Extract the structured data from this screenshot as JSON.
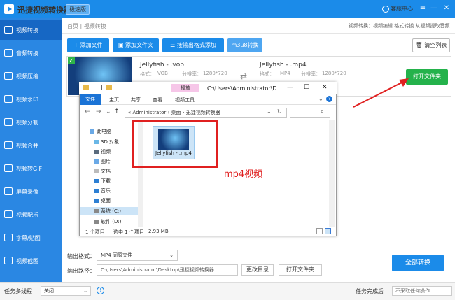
{
  "titlebar": {
    "app_title": "迅捷视频转换器",
    "badge": "极速版",
    "help_label": "客服中心"
  },
  "sidebar": {
    "items": [
      {
        "label": "视频转换",
        "active": true
      },
      {
        "label": "音频转换"
      },
      {
        "label": "视频压缩"
      },
      {
        "label": "视频水印"
      },
      {
        "label": "视频分割"
      },
      {
        "label": "视频合并"
      },
      {
        "label": "视频转GIF"
      },
      {
        "label": "屏幕录像"
      },
      {
        "label": "视频配乐"
      },
      {
        "label": "字幕/贴图"
      },
      {
        "label": "视频截图"
      }
    ]
  },
  "breadcrumb": {
    "home": "首页",
    "current": "视频转换",
    "right_text": "视频转换：视频编辑 格式转换 从视频提取音频"
  },
  "toolbar": {
    "add_file": "添加文件",
    "add_folder": "添加文件夹",
    "batch_format": "按输出格式添加",
    "m3u8": "m3u8转换",
    "clear_list": "清空列表"
  },
  "task": {
    "source_name": "Jellyfish - .vob",
    "target_name": "Jellyfish - .mp4",
    "format_label": "格式：",
    "resolution_label": "分辨率：",
    "source_format": "VOB",
    "target_format": "MP4",
    "resolution": "1280*720",
    "open_folder": "打开文件夹"
  },
  "explorer": {
    "play_tab": "播放",
    "title_path": "C:\\Users\\Administrator\\D...",
    "ribbon_tabs": [
      "文件",
      "主页",
      "共享",
      "查看",
      "视频工具"
    ],
    "address": {
      "root": "«",
      "parts": [
        "Administrator",
        "桌面",
        "迅捷视频转换器"
      ]
    },
    "tree": [
      "此电脑",
      "3D 对象",
      "视频",
      "图片",
      "文档",
      "下载",
      "音乐",
      "桌面",
      "系统 (C:)",
      "软件 (D:)"
    ],
    "file_name": "Jellyfish - .mp4",
    "status": {
      "count": "1 个项目",
      "selected": "选中 1 个项目",
      "size": "2.93 MB"
    }
  },
  "annotation": {
    "mp4_label": "mp4视频"
  },
  "output": {
    "format_label": "输出格式：",
    "format_value": "MP4  同原文件",
    "path_label": "输出路径：",
    "path_value": "C:\\Users\\Administrator\\Desktop\\迅捷视频转换器",
    "change_dir": "更改目录",
    "open_folder": "打开文件夹",
    "convert_all": "全部转换"
  },
  "statusbar": {
    "multithread_label": "任务多线程",
    "multithread_value": "关闭",
    "done_label": "任务完成后",
    "done_value": "不采取任何操作"
  },
  "colors": {
    "brand_blue": "#1b8be9",
    "green": "#24b24b",
    "annotation_red": "#e02020"
  }
}
